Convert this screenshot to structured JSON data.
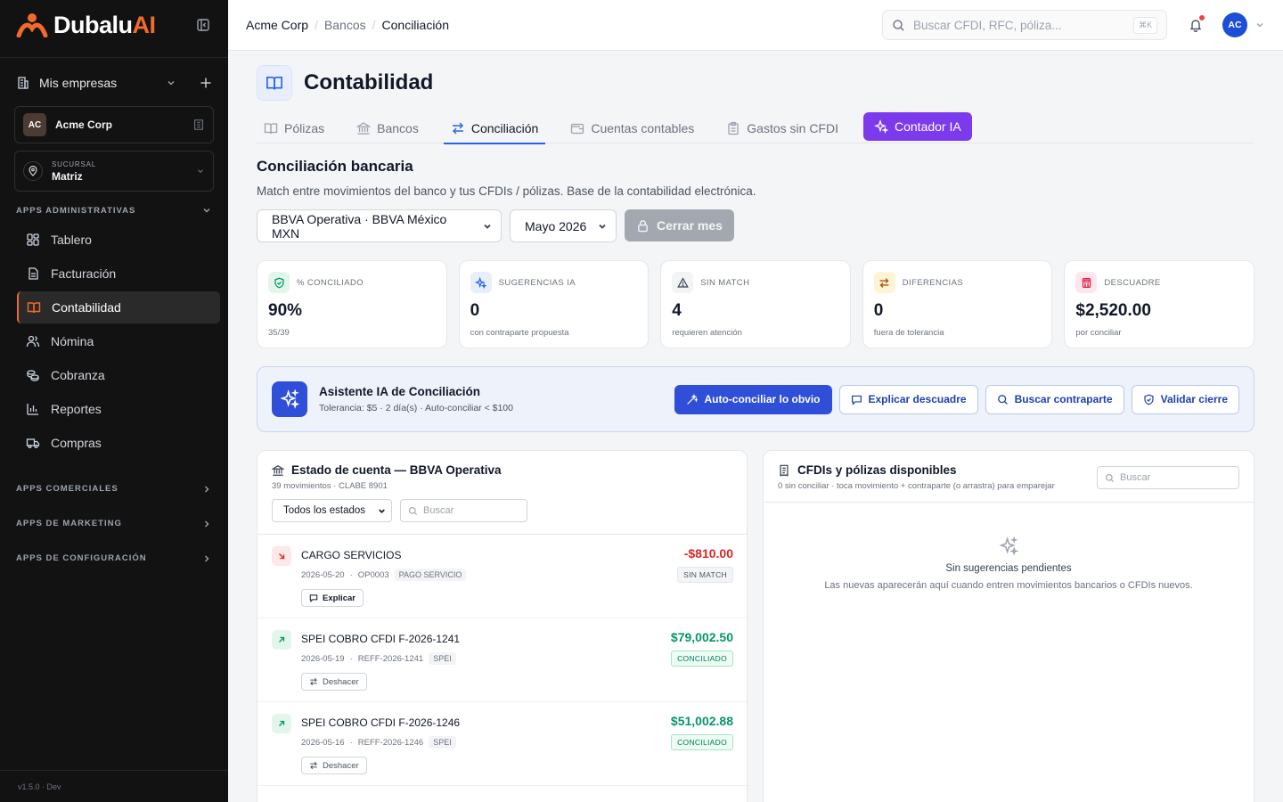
{
  "brand": {
    "name": "Dubalu",
    "name_accent": "AI",
    "accent_color": "#f26b2a"
  },
  "sidebar": {
    "mis_empresas": "Mis empresas",
    "company": {
      "initials": "AC",
      "name": "Acme Corp"
    },
    "branch": {
      "label": "SUCURSAL",
      "value": "Matriz"
    },
    "admin_section": "APPS ADMINISTRATIVAS",
    "items": [
      {
        "label": "Tablero",
        "icon": "grid-icon"
      },
      {
        "label": "Facturación",
        "icon": "document-icon"
      },
      {
        "label": "Contabilidad",
        "icon": "book-icon",
        "active": true
      },
      {
        "label": "Nómina",
        "icon": "users-icon"
      },
      {
        "label": "Cobranza",
        "icon": "coins-icon"
      },
      {
        "label": "Reportes",
        "icon": "bar-chart-icon"
      },
      {
        "label": "Compras",
        "icon": "truck-icon"
      }
    ],
    "collapsed_sections": [
      "APPS COMERCIALES",
      "APPS DE MARKETING",
      "APPS DE CONFIGURACIÓN"
    ],
    "version": "v1.5.0 · Dev"
  },
  "topbar": {
    "breadcrumb": [
      "Acme Corp",
      "Bancos",
      "Conciliación"
    ],
    "search_placeholder": "Buscar CFDI, RFC, póliza...",
    "search_kbd": "⌘K",
    "user_initials": "AC"
  },
  "page": {
    "title": "Contabilidad",
    "tabs": [
      {
        "label": "Pólizas",
        "icon": "book-open-icon"
      },
      {
        "label": "Bancos",
        "icon": "bank-icon"
      },
      {
        "label": "Conciliación",
        "icon": "arrows-swap-icon",
        "active": true
      },
      {
        "label": "Cuentas contables",
        "icon": "wallet-icon"
      },
      {
        "label": "Gastos sin CFDI",
        "icon": "clipboard-icon"
      },
      {
        "label": "Contador IA",
        "icon": "sparkles-icon",
        "ai": true
      }
    ],
    "section_title": "Conciliación bancaria",
    "section_desc": "Match entre movimientos del banco y tus CFDIs / pólizas. Base de la contabilidad electrónica.",
    "account_select": "BBVA Operativa · BBVA México MXN",
    "month_select": "Mayo 2026",
    "close_month_label": "Cerrar mes"
  },
  "kpis": [
    {
      "label": "% CONCILIADO",
      "value": "90%",
      "sub": "35/39",
      "icon": "shield-check-icon",
      "bg": "#e3f6ec",
      "fg": "#059669"
    },
    {
      "label": "SUGERENCIAS IA",
      "value": "0",
      "sub": "con contraparte propuesta",
      "icon": "sparkles-icon",
      "bg": "#e8eefb",
      "fg": "#2563eb"
    },
    {
      "label": "SIN MATCH",
      "value": "4",
      "sub": "requieren atención",
      "icon": "warning-icon",
      "bg": "#f3f4f6",
      "fg": "#374151"
    },
    {
      "label": "DIFERENCIAS",
      "value": "0",
      "sub": "fuera de tolerancia",
      "icon": "arrows-swap-icon",
      "bg": "#fdf3d6",
      "fg": "#b45309"
    },
    {
      "label": "DESCUADRE",
      "value": "$2,520.00",
      "sub": "por conciliar",
      "icon": "calculator-icon",
      "bg": "#fde7ec",
      "fg": "#e11d48"
    }
  ],
  "ai_assistant": {
    "title": "Asistente IA de Conciliación",
    "subtitle": "Tolerancia: $5 · 2 día(s) · Auto-conciliar < $100",
    "actions": {
      "auto": "Auto-conciliar lo obvio",
      "explain": "Explicar descuadre",
      "find": "Buscar contraparte",
      "validate": "Validar cierre"
    }
  },
  "statement": {
    "title": "Estado de cuenta — BBVA Operativa",
    "subtitle": "39 movimientos · CLABE 8901",
    "filter_select": "Todos los estados",
    "search_placeholder": "Buscar",
    "movements": [
      {
        "title": "CARGO SERVICIOS",
        "date": "2026-05-20",
        "ref": "OP0003",
        "tag": "PAGO SERVICIO",
        "amount": "-$810.00",
        "direction": "out",
        "status": "SIN MATCH",
        "action": "Explicar",
        "action_icon": "comment-icon"
      },
      {
        "title": "SPEI COBRO CFDI F-2026-1241",
        "date": "2026-05-19",
        "ref": "REFF-2026-1241",
        "tag": "SPEI",
        "amount": "$79,002.50",
        "direction": "in",
        "status": "CONCILIADO",
        "action": "Deshacer",
        "action_icon": "arrows-swap-icon"
      },
      {
        "title": "SPEI COBRO CFDI F-2026-1246",
        "date": "2026-05-16",
        "ref": "REFF-2026-1246",
        "tag": "SPEI",
        "amount": "$51,002.88",
        "direction": "in",
        "status": "CONCILIADO",
        "action": "Deshacer",
        "action_icon": "arrows-swap-icon"
      }
    ]
  },
  "available": {
    "title": "CFDIs y pólizas disponibles",
    "subtitle": "0 sin conciliar · toca movimiento + contraparte (o arrastra) para emparejar",
    "search_placeholder": "Buscar",
    "empty_title": "Sin sugerencias pendientes",
    "empty_sub": "Las nuevas aparecerán aquí cuando entren movimientos bancarios o CFDIs nuevos."
  }
}
